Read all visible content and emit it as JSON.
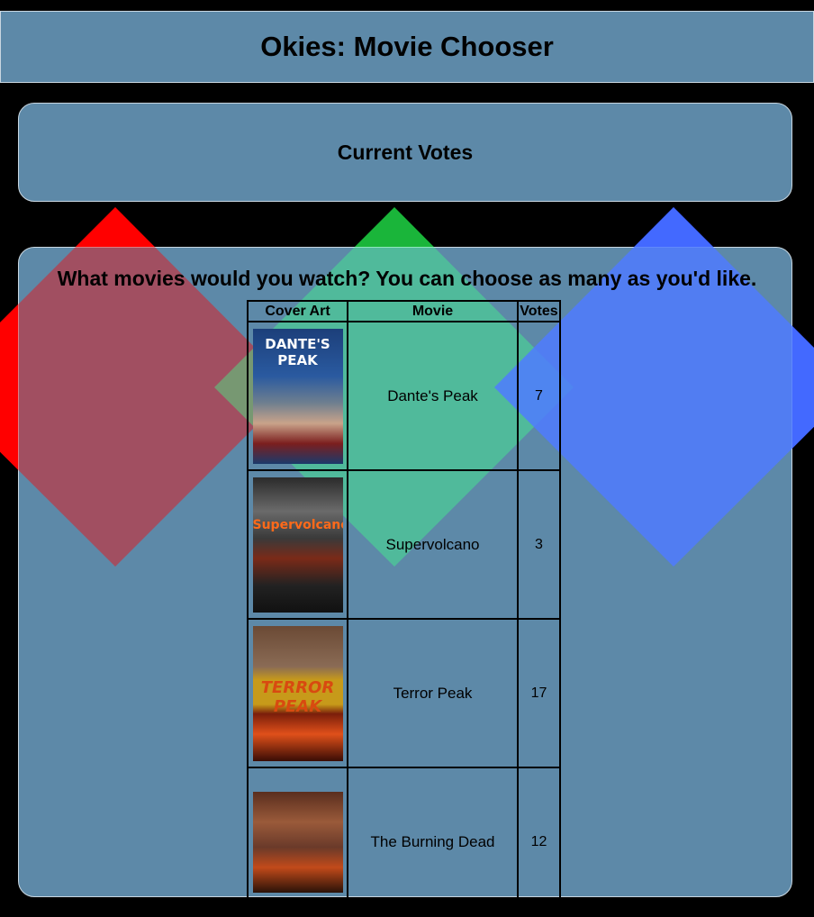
{
  "header": {
    "title": "Okies: Movie Chooser"
  },
  "votes_panel": {
    "heading": "Current Votes"
  },
  "chooser": {
    "question": "What movies would you watch? You can choose as many as you'd like.",
    "columns": {
      "cover": "Cover Art",
      "movie": "Movie",
      "votes": "Votes"
    },
    "rows": [
      {
        "title": "Dante's Peak",
        "votes": "7",
        "poster_text": "DANTE'S PEAK"
      },
      {
        "title": "Supervolcano",
        "votes": "3",
        "poster_text": "Supervolcano"
      },
      {
        "title": "Terror Peak",
        "votes": "17",
        "poster_text": "TERROR PEAK"
      },
      {
        "title": "The Burning Dead",
        "votes": "12",
        "poster_text": ""
      }
    ]
  },
  "colors": {
    "page_bg": "#000000",
    "panel_bg": "#5d89a8",
    "diamond_red": "#ff0000",
    "diamond_green": "#008000",
    "diamond_blue": "#0000ff"
  }
}
